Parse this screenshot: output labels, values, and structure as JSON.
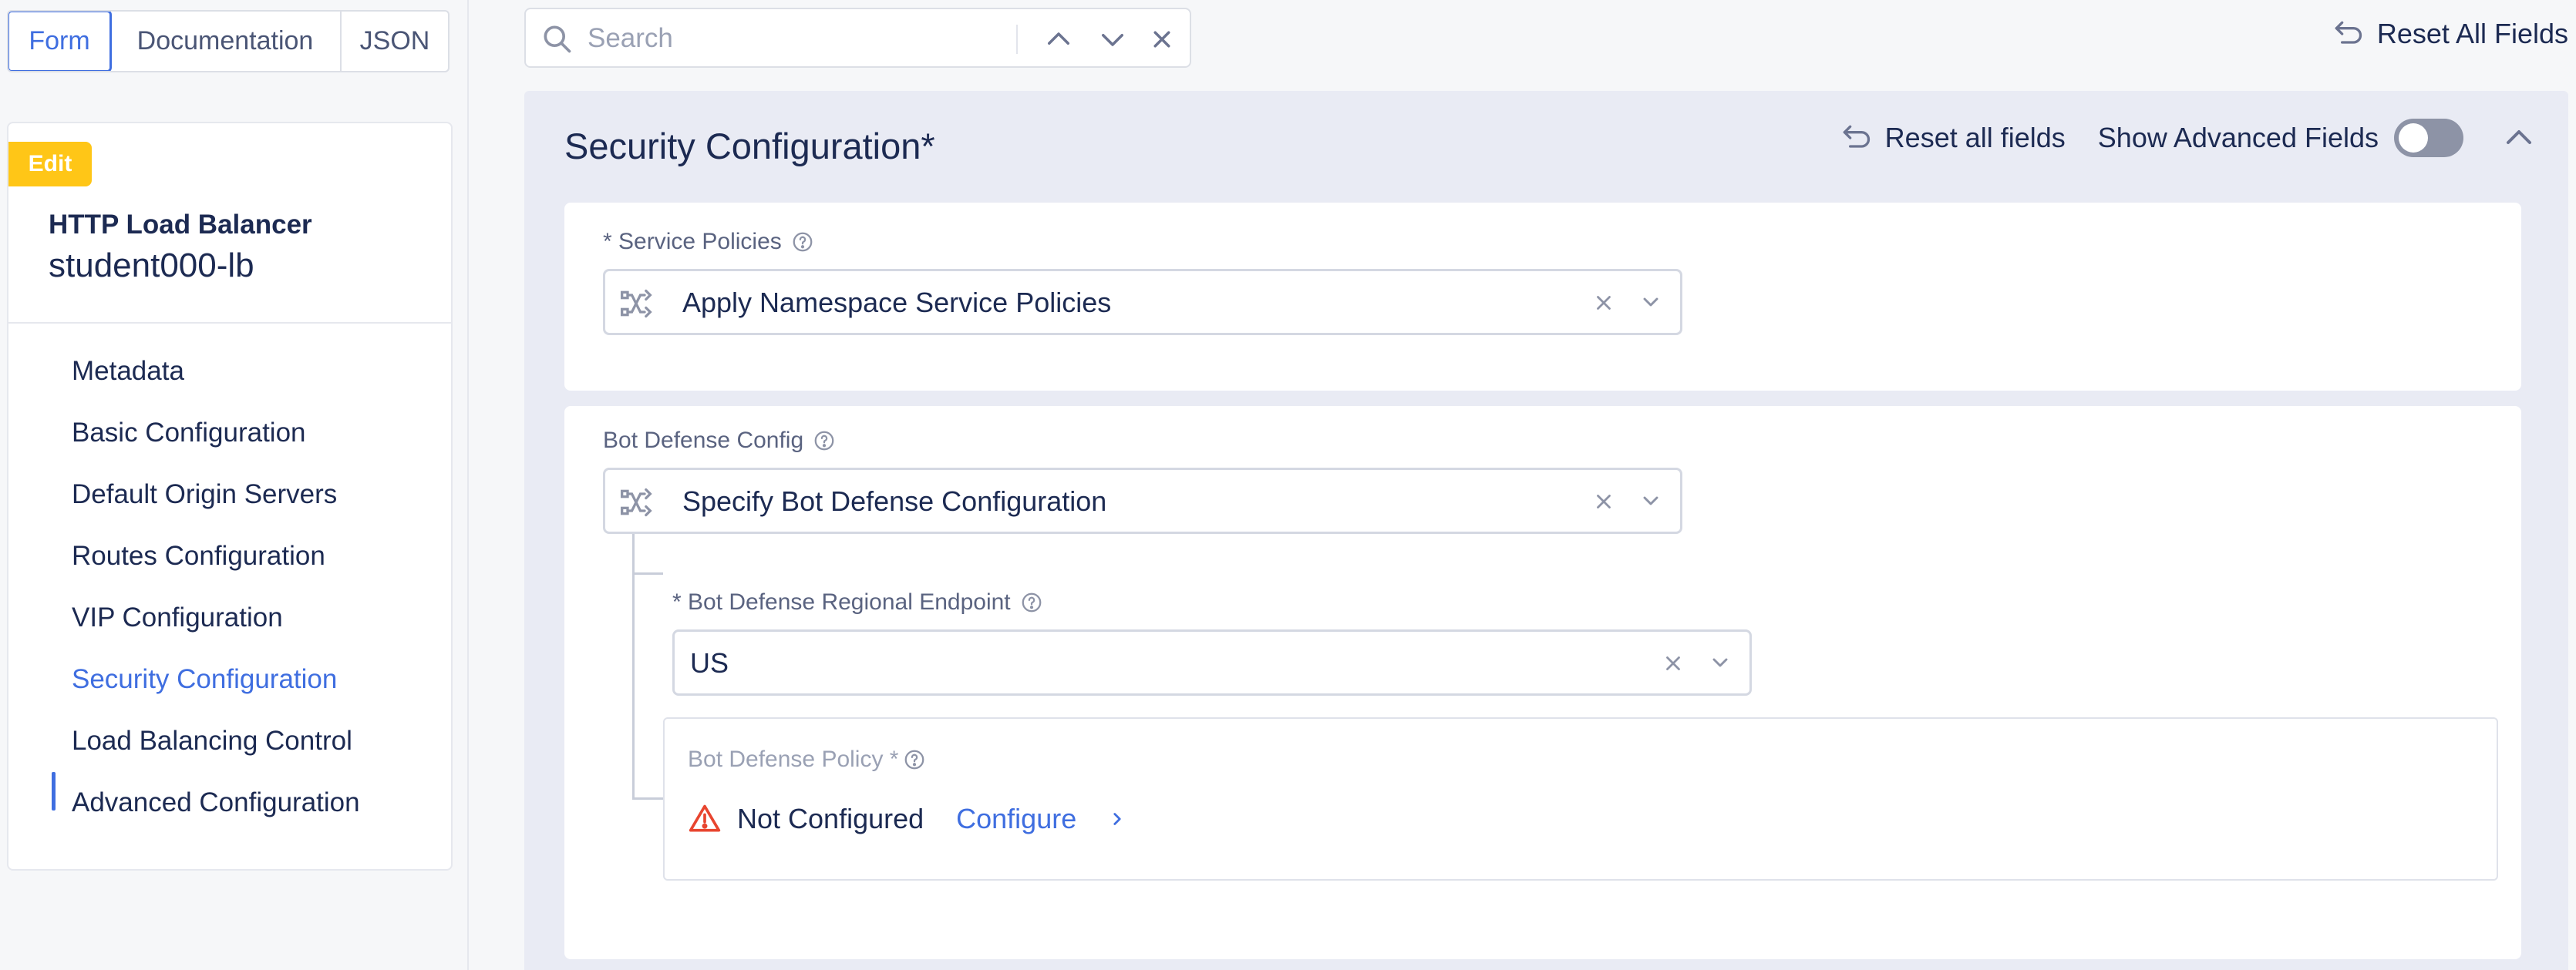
{
  "view_tabs": [
    "Form",
    "Documentation",
    "JSON"
  ],
  "search": {
    "placeholder": "Search"
  },
  "reset_all_top": "Reset All Fields",
  "sidebar": {
    "badge": "Edit",
    "object_type": "HTTP Load Balancer",
    "object_name": "student000-lb",
    "items": [
      {
        "label": "Metadata"
      },
      {
        "label": "Basic Configuration"
      },
      {
        "label": "Default Origin Servers"
      },
      {
        "label": "Routes Configuration"
      },
      {
        "label": "VIP Configuration"
      },
      {
        "label": "Security Configuration",
        "active": true
      },
      {
        "label": "Load Balancing Control"
      },
      {
        "label": "Advanced Configuration"
      }
    ]
  },
  "panel": {
    "title": "Security Configuration",
    "required_mark": "*",
    "reset_fields": "Reset all fields",
    "advanced_label": "Show Advanced Fields",
    "advanced_on": false
  },
  "service_policies": {
    "label": "* Service Policies",
    "value": "Apply Namespace Service Policies"
  },
  "bot_defense": {
    "label": "Bot Defense Config",
    "value": "Specify Bot Defense Configuration",
    "endpoint_label": "* Bot Defense Regional Endpoint",
    "endpoint_value": "US",
    "policy_label": "Bot Defense Policy *",
    "policy_status": "Not Configured",
    "policy_action": "Configure"
  },
  "colors": {
    "accent": "#3f6ee0",
    "badge": "#ffc617",
    "warning": "#e8452f"
  }
}
